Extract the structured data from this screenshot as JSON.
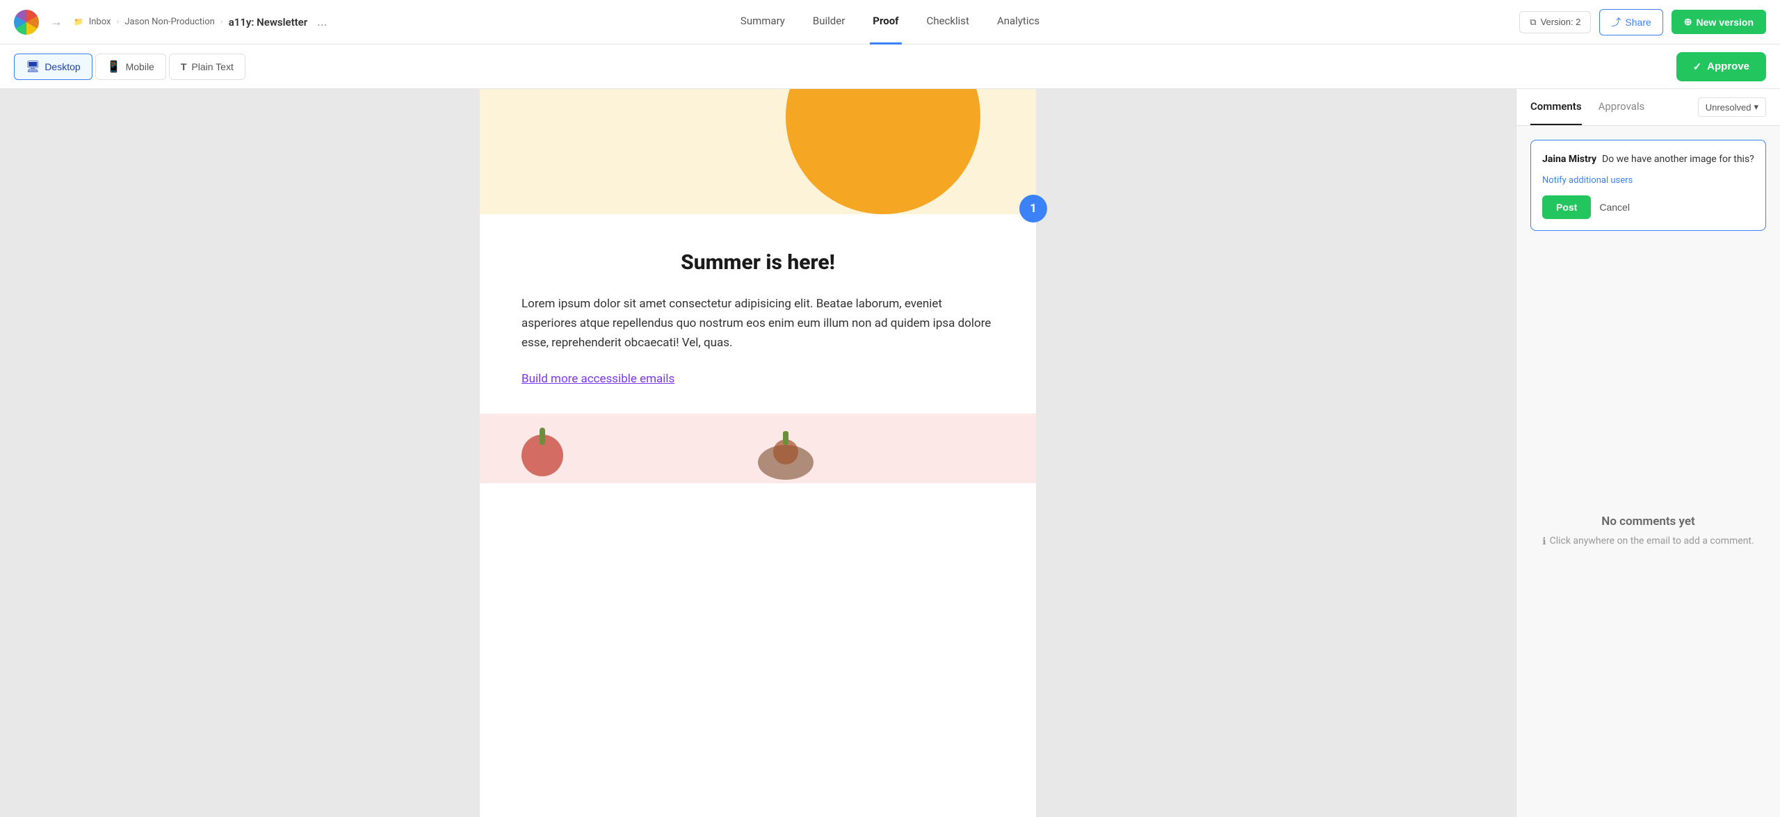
{
  "app": {
    "logo_alt": "Litmus logo"
  },
  "breadcrumb": {
    "inbox": "Inbox",
    "separator": "›",
    "project": "Jason Non-Production",
    "title": "a11y: Newsletter",
    "dots": "..."
  },
  "nav": {
    "tabs": [
      {
        "id": "summary",
        "label": "Summary",
        "active": false
      },
      {
        "id": "builder",
        "label": "Builder",
        "active": false
      },
      {
        "id": "proof",
        "label": "Proof",
        "active": true
      },
      {
        "id": "checklist",
        "label": "Checklist",
        "active": false
      },
      {
        "id": "analytics",
        "label": "Analytics",
        "active": false
      }
    ],
    "version_label": "Version: 2",
    "share_label": "Share",
    "new_version_label": "New version"
  },
  "toolbar": {
    "views": [
      {
        "id": "desktop",
        "label": "Desktop",
        "icon": "🖥",
        "active": true
      },
      {
        "id": "mobile",
        "label": "Mobile",
        "icon": "📱",
        "active": false
      },
      {
        "id": "plain_text",
        "label": "Plain Text",
        "icon": "T",
        "active": false
      }
    ],
    "approve_label": "Approve"
  },
  "email": {
    "heading": "Summer is here!",
    "body": "Lorem ipsum dolor sit amet consectetur adipisicing elit. Beatae laborum, eveniet asperiores atque repellendus quo nostrum eos enim eum illum non ad quidem ipsa dolore esse, reprehenderit obcaecati! Vel, quas.",
    "link_text": "Build more accessible emails",
    "comment_badge": "1"
  },
  "panel": {
    "tabs": [
      {
        "id": "comments",
        "label": "Comments",
        "active": true
      },
      {
        "id": "approvals",
        "label": "Approvals",
        "active": false
      }
    ],
    "filter_label": "Unresolved",
    "comment": {
      "user": "Jaina Mistry",
      "text": "Do we have another image for this?",
      "notify_label": "Notify additional users",
      "post_label": "Post",
      "cancel_label": "Cancel"
    },
    "no_comments_title": "No comments yet",
    "no_comments_sub": "Click anywhere on the email to add a comment."
  }
}
